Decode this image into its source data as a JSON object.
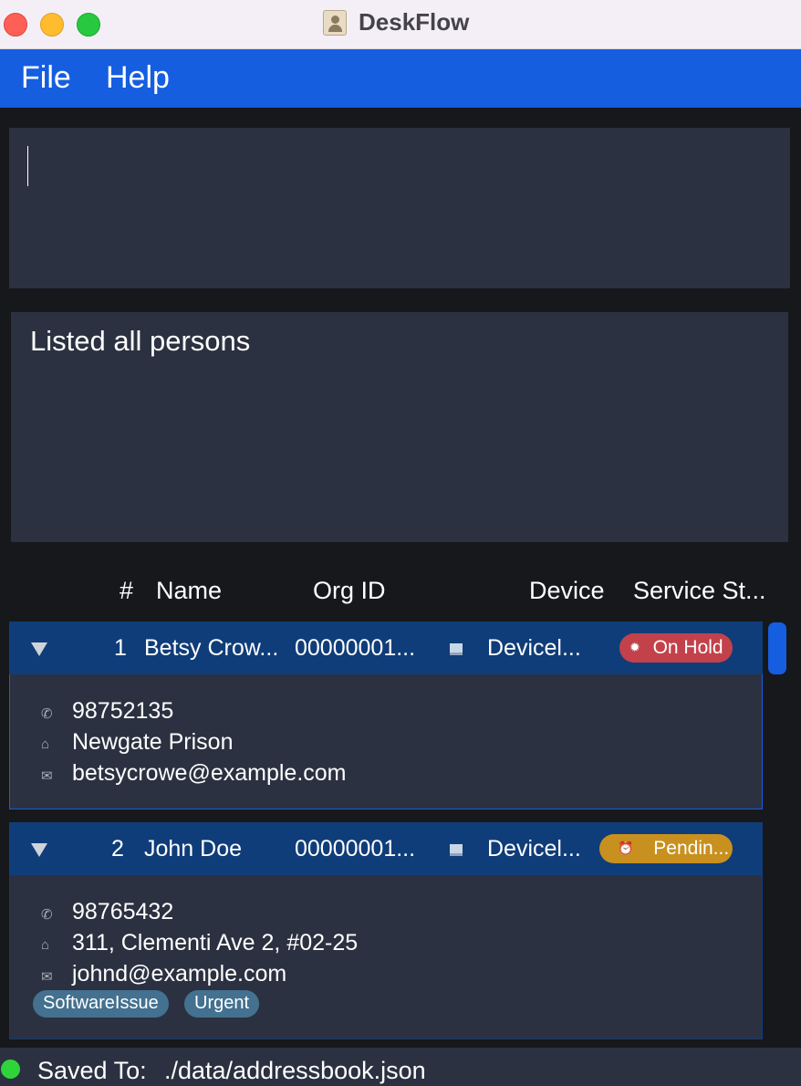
{
  "window": {
    "title": "DeskFlow",
    "app_icon": "contacts-book-icon"
  },
  "menu": {
    "file": "File",
    "help": "Help"
  },
  "command_box": {
    "value": ""
  },
  "result": {
    "message": "Listed all persons"
  },
  "table": {
    "headers": {
      "index": "#",
      "name": "Name",
      "org_id": "Org ID",
      "device": "Device",
      "service_status": "Service St..."
    },
    "rows": [
      {
        "index": "1",
        "name": "Betsy Crow...",
        "org_id": "00000001...",
        "device_icon": "laptop-icon",
        "device": "Devicel...",
        "status": {
          "label": "On Hold",
          "icon": "gear-icon",
          "color": "#c3414a"
        },
        "phone": "98752135",
        "address": "Newgate Prison",
        "email": "betsycrowe@example.com",
        "tags": []
      },
      {
        "index": "2",
        "name": "John Doe",
        "org_id": "00000001...",
        "device_icon": "laptop-icon",
        "device": "Devicel...",
        "status": {
          "label": "Pendin...",
          "icon": "alarm-clock-icon",
          "color": "#c8901e"
        },
        "phone": "98765432",
        "address": "311, Clementi Ave 2, #02-25",
        "email": "johnd@example.com",
        "tags": [
          "SoftwareIssue",
          "Urgent"
        ]
      }
    ]
  },
  "statusbar": {
    "label": "Saved To:",
    "path": "./data/addressbook.json",
    "indicator_color": "#2fd43a"
  },
  "colors": {
    "accent": "#155ee0",
    "panel": "#2b3140",
    "row_header": "#0f3d79",
    "background": "#16181c",
    "tag": "#43718f"
  }
}
